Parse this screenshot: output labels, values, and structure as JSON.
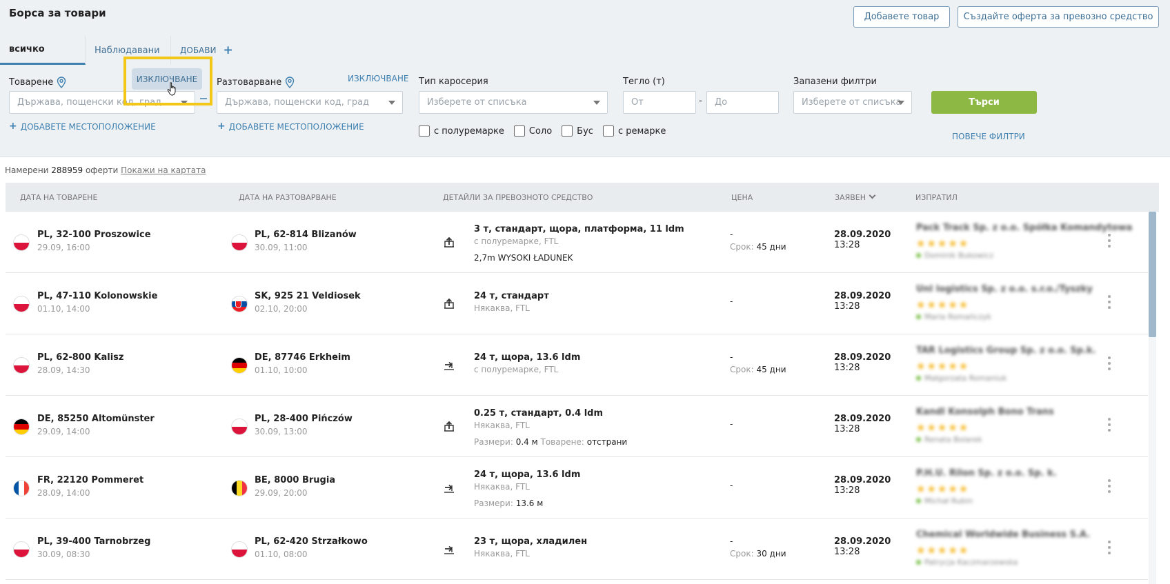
{
  "header": {
    "title": "Борса за товари",
    "add_cargo_button": "Добавете товар",
    "create_vehicle_offer_button": "Създайте оферта за превозно средство"
  },
  "tabs": {
    "all": "всичко",
    "watched": "Наблюдавани",
    "add": "ДОБАВИ"
  },
  "filters": {
    "loading_label": "Товарене",
    "loading_exclude": "ИЗКЛЮЧВАНЕ",
    "loading_placeholder": "Държава, пощенски код, град",
    "unloading_label": "Разтоварване",
    "unloading_exclude": "ИЗКЛЮЧВАНЕ",
    "unloading_placeholder": "Държава, пощенски код, град",
    "add_location": "ДОБАВЕТЕ МЕСТОПОЛОЖЕНИЕ",
    "body_type_label": "Тип каросерия",
    "body_type_placeholder": "Изберете от списъка",
    "weight_label": "Тегло (т)",
    "weight_from": "От",
    "weight_sep": "-",
    "weight_to": "До",
    "saved_filters_label": "Запазени филтри",
    "saved_filters_placeholder": "Изберете от списъка",
    "search_button": "Търси",
    "more_filters": "ПОВЕЧЕ ФИЛТРИ",
    "checkboxes": [
      "с полуремарке",
      "Соло",
      "Бус",
      "с ремарке"
    ]
  },
  "results": {
    "found_prefix": "Намерени",
    "count": "288959",
    "found_suffix": "оферти",
    "show_on_map": "Покажи на картата"
  },
  "columns": {
    "loading_date": "ДАТА НА ТОВАРЕНЕ",
    "unloading_date": "ДАТА НА РАЗТОВАРВАНЕ",
    "vehicle_details": "ДЕТАЙЛИ ЗА ПРЕВОЗНОТО СРЕДСТВО",
    "price": "ЦЕНА",
    "posted": "ЗАЯВЕН",
    "sender": "ИЗПРАТИЛ"
  },
  "rows": [
    {
      "from_flag": "PL",
      "from_city": "PL, 32-100 Proszowice",
      "from_date": "29.09, 16:00",
      "to_flag": "PL",
      "to_city": "PL, 62-814 Blizanów",
      "to_date": "30.09, 11:00",
      "icon": "upload-truck-icon",
      "detail1": "3 т, стандарт, щора, платформа, 11 ldm",
      "detail2": "с полуремарке, FTL",
      "detail3": "2,7m WYSOKI ŁADUNEK",
      "price": "-",
      "term_label": "Срок:",
      "term_value": "45 дни",
      "posted_date": "28.09.2020",
      "posted_time": "13:28",
      "sender_name": "Pack Track Sp. z o.o. Spółka Komandytowa",
      "sender_person": "Dominik Bukowicz"
    },
    {
      "from_flag": "PL",
      "from_city": "PL, 47-110 Kolonowskie",
      "from_date": "01.10, 14:00",
      "to_flag": "SK",
      "to_city": "SK, 925 21 Veldiosek",
      "to_date": "02.10, 20:00",
      "icon": "upload-truck-icon",
      "detail1": "24 т, стандарт",
      "detail2": "Някаква, FTL",
      "price": "-",
      "posted_date": "28.09.2020",
      "posted_time": "13:28",
      "sender_name": "Unl logistics Sp. z o.o. s.r.o./Tyszky",
      "sender_person": "Maria Romańczyk"
    },
    {
      "from_flag": "PL",
      "from_city": "PL, 62-800 Kalisz",
      "from_date": "28.09, 14:30",
      "to_flag": "DE",
      "to_city": "DE, 87746 Erkheim",
      "to_date": "01.10, 10:00",
      "icon": "transfer-truck-icon",
      "detail1": "24 т, щора, 13.6 ldm",
      "detail2": "с полуремарке, FTL",
      "price": "-",
      "term_label": "Срок:",
      "term_value": "45 дни",
      "posted_date": "28.09.2020",
      "posted_time": "13:28",
      "sender_name": "TAR Logistics Group Sp. z o.o. Sp.k.",
      "sender_person": "Małgorzata Romaniuk"
    },
    {
      "from_flag": "DE",
      "from_city": "DE, 85250 Altomünster",
      "from_date": "29.09, 14:00",
      "to_flag": "PL",
      "to_city": "PL, 28-400 Pińczów",
      "to_date": "30.09, 13:00",
      "icon": "upload-truck-icon",
      "detail1": "0.25 т, стандарт, 0.4 ldm",
      "detail2": "Някаква, FTL",
      "detail3_label1": "Размери:",
      "detail3_value1": "0.4 м",
      "detail3_label2": "Товарене:",
      "detail3_value2": "отстрани",
      "price": "-",
      "posted_date": "28.09.2020",
      "posted_time": "13:28",
      "sender_name": "Kandl Konsolph Bono Trans",
      "sender_person": "Renata Bolarek"
    },
    {
      "from_flag": "FR",
      "from_city": "FR, 22120 Pommeret",
      "from_date": "28.09, 14:00",
      "to_flag": "BE",
      "to_city": "BE, 8000 Brugia",
      "to_date": "29.09, 20:00",
      "icon": "transfer-truck-icon",
      "detail1": "24 т, щора, 13.6 ldm",
      "detail2": "Някаква, FTL",
      "detail3_label1": "Размери:",
      "detail3_value1": "13.6 м",
      "price": "-",
      "posted_date": "28.09.2020",
      "posted_time": "13:28",
      "sender_name": "P.H.U. Rilon Sp. z o.o. Sp. k.",
      "sender_person": "Michał Rubin"
    },
    {
      "from_flag": "PL",
      "from_city": "PL, 39-400 Tarnobrzeg",
      "from_date": "30.09, 08:30",
      "to_flag": "PL",
      "to_city": "PL, 62-420 Strzałkowo",
      "to_date": "01.10, 08:00",
      "icon": "transfer-truck-icon",
      "detail1": "23 т, щора, хладилен",
      "detail2": "Някаква, FTL",
      "price": "-",
      "term_label": "Срок:",
      "term_value": "30 дни",
      "posted_date": "28.09.2020",
      "posted_time": "13:28",
      "sender_name": "Chemical Worldwide Business S.A.",
      "sender_person": "Patrycja Kaczmarzewska"
    }
  ],
  "flag_colors": {
    "PL": [
      "#ffffff",
      "#dc143c"
    ],
    "SK": [
      "#ffffff",
      "#0b4ea2",
      "#ee1c25"
    ],
    "DE": [
      "#000000",
      "#dd0000",
      "#ffce00"
    ],
    "FR": [
      "#0055a4",
      "#ffffff",
      "#ef4135"
    ],
    "BE": [
      "#000000",
      "#fdda24",
      "#ef3340"
    ]
  },
  "colors": {
    "accent": "#3e80b0",
    "search_green": "#8cb843",
    "highlight_yellow": "#f2c718",
    "star": "#f5b51b"
  }
}
